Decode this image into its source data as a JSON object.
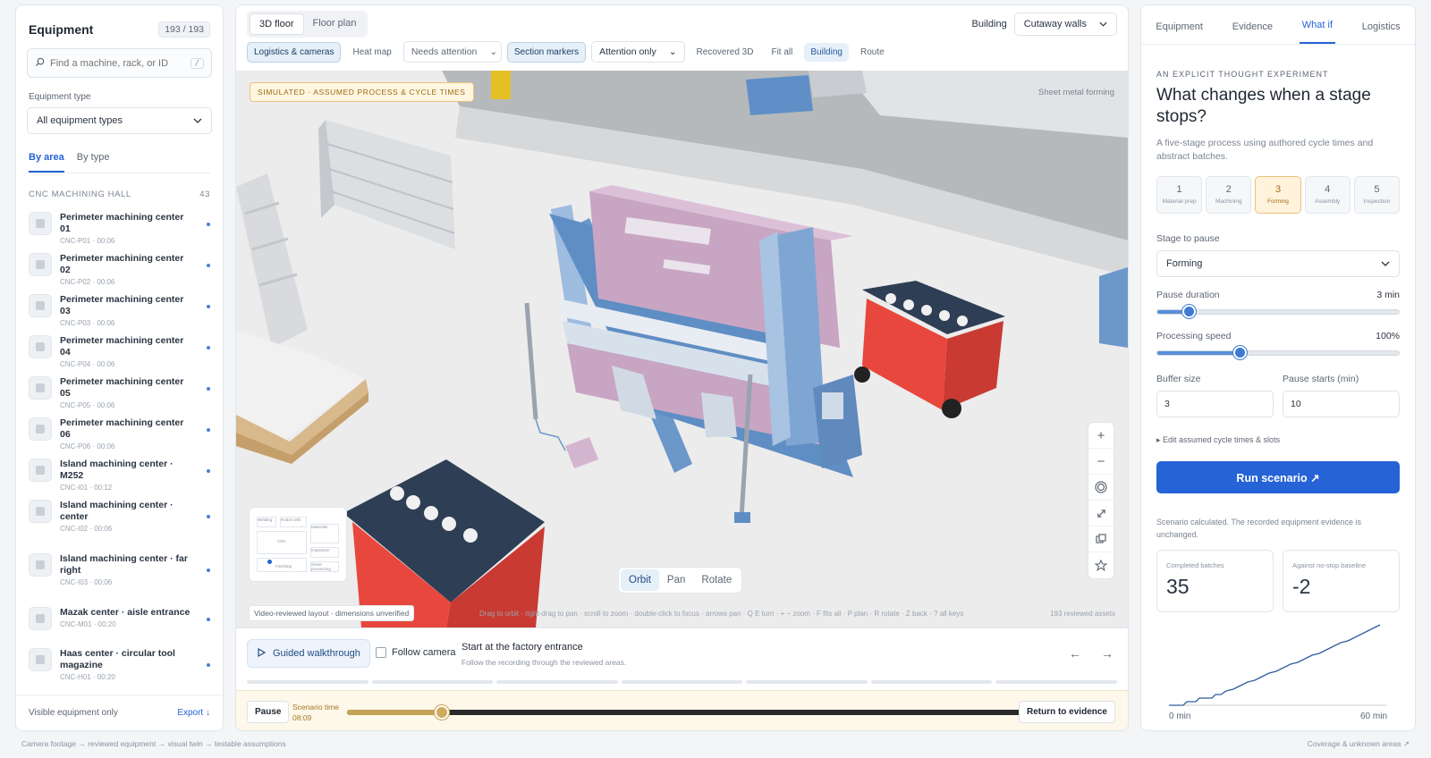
{
  "left": {
    "title": "Equipment",
    "count": "193 / 193",
    "search_placeholder": "Find a machine, rack, or ID",
    "search_shortcut": "/",
    "type_label": "Equipment type",
    "type_value": "All equipment types",
    "tabs": [
      {
        "label": "By area"
      },
      {
        "label": "By type"
      }
    ],
    "group": {
      "name": "CNC MACHINING HALL",
      "count": "43"
    },
    "items": [
      {
        "name": "Perimeter machining center 01",
        "sub": "CNC-P01 · 00:06"
      },
      {
        "name": "Perimeter machining center 02",
        "sub": "CNC-P02 · 00:06"
      },
      {
        "name": "Perimeter machining center 03",
        "sub": "CNC-P03 · 00:06"
      },
      {
        "name": "Perimeter machining center 04",
        "sub": "CNC-P04 · 00:06"
      },
      {
        "name": "Perimeter machining center 05",
        "sub": "CNC-P05 · 00:06"
      },
      {
        "name": "Perimeter machining center 06",
        "sub": "CNC-P06 · 00:06"
      },
      {
        "name": "Island machining center · M252",
        "sub": "CNC-I01 · 00:12"
      },
      {
        "name": "Island machining center · center",
        "sub": "CNC-I02 · 00:06"
      },
      {
        "name": "Island machining center · far right",
        "sub": "CNC-I03 · 00:06"
      },
      {
        "name": "Mazak center · aisle entrance",
        "sub": "CNC-M01 · 00:20"
      },
      {
        "name": "Haas center · circular tool magazine",
        "sub": "CNC-H01 · 00:20"
      }
    ],
    "footer_left": "Visible equipment only",
    "footer_right": "Export ↓"
  },
  "center": {
    "view_tabs": [
      {
        "label": "3D floor"
      },
      {
        "label": "Floor plan"
      }
    ],
    "building_label": "Building",
    "building_value": "Cutaway walls",
    "chips": {
      "logistics": "Logistics & cameras",
      "heatmap": "Heat map",
      "needs_attention": "Needs attention",
      "section_markers": "Section markers",
      "attention_only": "Attention only",
      "recovered": "Recovered 3D",
      "fit_all": "Fit all",
      "building": "Building",
      "route": "Route"
    },
    "sim_badge": "SIMULATED · ASSUMED PROCESS & CYCLE TIMES",
    "area_label": "Sheet metal forming",
    "modes": [
      {
        "label": "Orbit"
      },
      {
        "label": "Pan"
      },
      {
        "label": "Rotate"
      }
    ],
    "layout_note": "Video-reviewed layout · dimensions unverified",
    "nav_hint": "Drag to orbit · right-drag to pan · scroll to zoom · double-click to focus · arrows pan · Q E turn · + − zoom · F fits all · P plan · R rotate · Z back · ? all keys",
    "assets_count": "193 reviewed assets",
    "minimap": {
      "a": "Welding",
      "b": "Robot cells",
      "c": "Materials",
      "d": "CNC",
      "e": "Inspection",
      "f": "Finishing",
      "g": "Sheet processing"
    },
    "walkthrough": {
      "button": "Guided walkthrough",
      "follow": "Follow camera",
      "title": "Start at the factory entrance",
      "subtitle": "Follow the recording through the reviewed areas."
    },
    "timeline": {
      "pause": "Pause",
      "time_label": "Scenario time",
      "time_value": "08:09",
      "progress": 0.14,
      "return": "Return to evidence"
    }
  },
  "right": {
    "tabs": [
      {
        "label": "Equipment"
      },
      {
        "label": "Evidence"
      },
      {
        "label": "What if"
      },
      {
        "label": "Logistics"
      }
    ],
    "kicker": "AN EXPLICIT THOUGHT EXPERIMENT",
    "title": "What changes when a stage stops?",
    "desc": "A five-stage process using authored cycle times and abstract batches.",
    "stages": [
      {
        "num": "1",
        "name": "Material prep"
      },
      {
        "num": "2",
        "name": "Machining"
      },
      {
        "num": "3",
        "name": "Forming"
      },
      {
        "num": "4",
        "name": "Assembly"
      },
      {
        "num": "5",
        "name": "Inspection"
      }
    ],
    "stage_to_pause_label": "Stage to pause",
    "stage_to_pause_value": "Forming",
    "pause_duration_label": "Pause duration",
    "pause_duration_value": "3 min",
    "pause_duration_fraction": 0.13,
    "speed_label": "Processing speed",
    "speed_value": "100%",
    "speed_fraction": 0.34,
    "buffer_label": "Buffer size",
    "buffer_value": "3",
    "pause_start_label": "Pause starts (min)",
    "pause_start_value": "10",
    "edit_link": "▸ Edit assumed cycle times & slots",
    "run_button": "Run scenario ↗",
    "calc_note": "Scenario calculated. The recorded equipment evidence is unchanged.",
    "stat1_label": "Completed batches",
    "stat1_value": "35",
    "stat2_label": "Against no-stop baseline",
    "stat2_value": "-2",
    "chart_x_start": "0 min",
    "chart_x_end": "60 min"
  },
  "footer": {
    "left": "Camera footage → reviewed equipment → visual twin → testable assumptions",
    "right": "Coverage & unknown areas ↗"
  },
  "colors": {
    "accent": "#2563d6",
    "sim_amber": "#ecc27a",
    "machine_blue": "#6b97c9",
    "machine_pink": "#c9a6c4",
    "cart_red": "#e8473d"
  },
  "icons": [
    "search-icon",
    "chevron-down-icon",
    "plus-icon",
    "minus-icon",
    "compass-icon",
    "expand-icon",
    "layers-icon",
    "star-icon",
    "play-icon",
    "arrow-left-icon",
    "arrow-right-icon"
  ]
}
